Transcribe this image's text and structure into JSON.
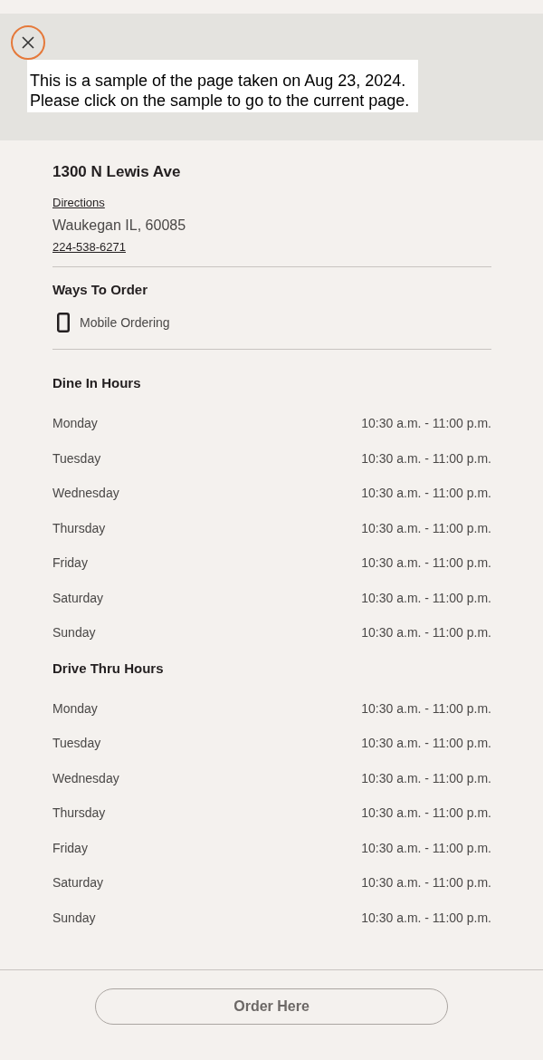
{
  "banner": {
    "lines": [
      "This is a sample of the page taken on Aug 23, 2024.",
      "Please click on the sample to go to the current page."
    ]
  },
  "location": {
    "address": "1300 N Lewis Ave",
    "directions_link": "Directions",
    "city_line": "Waukegan IL, 60085",
    "phone": "224-538-6271"
  },
  "ways_to_order": {
    "heading": "Ways To Order",
    "items": [
      {
        "label": "Mobile Ordering"
      }
    ]
  },
  "hours_sections": [
    {
      "heading": "Dine In Hours",
      "rows": [
        {
          "day": "Monday",
          "hours": "10:30 a.m. - 11:00 p.m."
        },
        {
          "day": "Tuesday",
          "hours": "10:30 a.m. - 11:00 p.m."
        },
        {
          "day": "Wednesday",
          "hours": "10:30 a.m. - 11:00 p.m."
        },
        {
          "day": "Thursday",
          "hours": "10:30 a.m. - 11:00 p.m."
        },
        {
          "day": "Friday",
          "hours": "10:30 a.m. - 11:00 p.m."
        },
        {
          "day": "Saturday",
          "hours": "10:30 a.m. - 11:00 p.m."
        },
        {
          "day": "Sunday",
          "hours": "10:30 a.m. - 11:00 p.m."
        }
      ]
    },
    {
      "heading": "Drive Thru Hours",
      "rows": [
        {
          "day": "Monday",
          "hours": "10:30 a.m. - 11:00 p.m."
        },
        {
          "day": "Tuesday",
          "hours": "10:30 a.m. - 11:00 p.m."
        },
        {
          "day": "Wednesday",
          "hours": "10:30 a.m. - 11:00 p.m."
        },
        {
          "day": "Thursday",
          "hours": "10:30 a.m. - 11:00 p.m."
        },
        {
          "day": "Friday",
          "hours": "10:30 a.m. - 11:00 p.m."
        },
        {
          "day": "Saturday",
          "hours": "10:30 a.m. - 11:00 p.m."
        },
        {
          "day": "Sunday",
          "hours": "10:30 a.m. - 11:00 p.m."
        }
      ]
    }
  ],
  "footer": {
    "order_button": "Order Here"
  }
}
